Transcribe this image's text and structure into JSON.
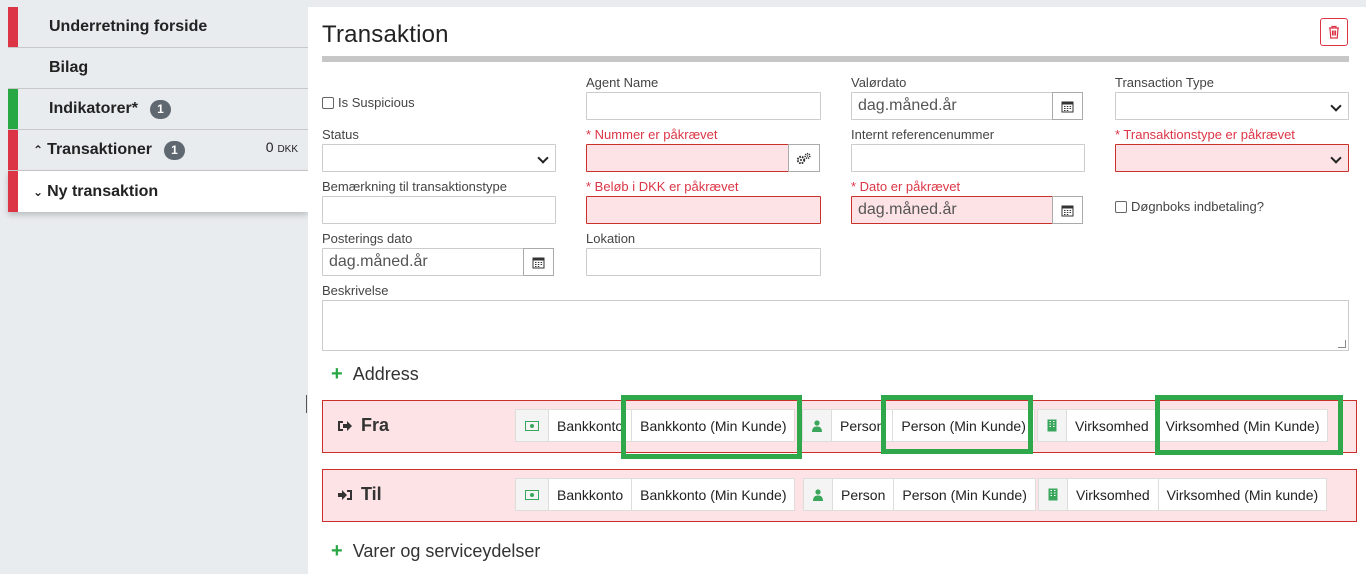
{
  "sidebar": {
    "items": [
      {
        "label": "Underretning forside"
      },
      {
        "label": "Bilag"
      },
      {
        "label": "Indikatorer*",
        "badge": "1"
      },
      {
        "label": "Transaktioner",
        "badge": "1",
        "amount": "0",
        "currency": "DKK"
      },
      {
        "label": "Ny transaktion"
      }
    ]
  },
  "page": {
    "title": "Transaktion"
  },
  "form": {
    "is_suspicious": "Is Suspicious",
    "agent_name": "Agent Name",
    "valoerdato": "Valørdato",
    "date_placeholder": "dag.måned.år",
    "transaction_type": "Transaction Type",
    "status": "Status",
    "nummer_required": "* Nummer er påkrævet",
    "internt_ref": "Internt referencenummer",
    "transaktionstype_required": "* Transaktionstype er påkrævet",
    "bemaerkning": "Bemærkning til transaktionstype",
    "beloeb_required": "* Beløb i DKK er påkrævet",
    "dato_required": "* Dato er påkrævet",
    "doegnboks": "Døgnboks indbetaling?",
    "posterings_dato": "Posterings dato",
    "lokation": "Lokation",
    "beskrivelse": "Beskrivelse"
  },
  "sections": {
    "address": "Address",
    "varer": "Varer og serviceydelser"
  },
  "parties": {
    "fra": {
      "title": "Fra",
      "bankkonto": "Bankkonto",
      "bankkonto_min": "Bankkonto (Min Kunde)",
      "person": "Person",
      "person_min": "Person (Min Kunde)",
      "virksomhed": "Virksomhed",
      "virksomhed_min": "Virksomhed (Min Kunde)"
    },
    "til": {
      "title": "Til",
      "bankkonto": "Bankkonto",
      "bankkonto_min": "Bankkonto (Min Kunde)",
      "person": "Person",
      "person_min": "Person (Min Kunde)",
      "virksomhed": "Virksomhed",
      "virksomhed_min": "Virksomhed (Min kunde)"
    }
  },
  "colors": {
    "required": "#dc3545",
    "highlight": "#2ea84a",
    "add": "#28a745"
  }
}
